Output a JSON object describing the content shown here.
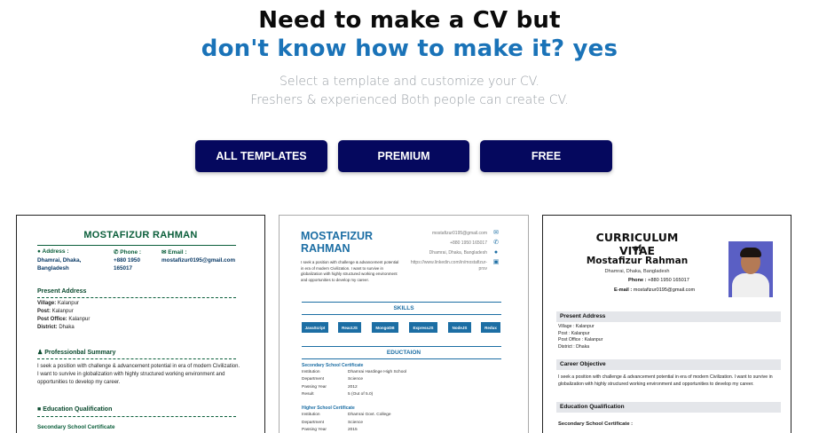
{
  "hero": {
    "line1": "Need to make a CV but",
    "line2": "don't know how to make it? yes",
    "sub1": "Select a template and customize your CV.",
    "sub2": "Freshers & experienced Both people can create CV."
  },
  "filters": {
    "all": "ALL TEMPLATES",
    "premium": "PREMIUM",
    "free": "FREE"
  },
  "colors": {
    "button_bg": "#05085e",
    "accent_blue": "#1a73b8",
    "template1_green": "#0a5e3a"
  },
  "template1": {
    "name": "MOSTAFIZUR RAHMAN",
    "address_label": "Address :",
    "address_value": "Dhamrai, Dhaka, Bangladesh",
    "phone_label": "Phone :",
    "phone_value": "+880 1950 165017",
    "email_label": "Email :",
    "email_value": "mostafizur0195@gmail.com",
    "present_address": "Present Address",
    "village_k": "Village:",
    "village_v": "Kalanpur",
    "post_k": "Post:",
    "post_v": "Kalanpur",
    "postoffice_k": "Post Office:",
    "postoffice_v": "Kalanpur",
    "district_k": "District:",
    "district_v": "Dhaka",
    "summary_title": "Professionbal Summary",
    "summary_text": "I seek a position with challenge & advancement potential in era of modern Civilization. I want to survive in globalization with highly structured working environment and opportunities to develop my career.",
    "education_title": "Education Qualification",
    "ssc": "Secondary School Certificate"
  },
  "template2": {
    "name_line1": "MOSTAFIZUR",
    "name_line2": "RAHMAN",
    "about": "I seek a position with challenge & advancement potential in era of modern Civilization. I want to survive in globalization with highly structured working environment and opportunities to develop my career.",
    "email": "mostafizur0195@gmail.com",
    "phone": "+880 1950 165017",
    "address": "Dhamrai, Dhaka, Bangladesh",
    "linkedin1": "https://www.linkedin.com/in/mostafizur-",
    "linkedin2": "prsv",
    "skills_title": "SKILLS",
    "skills": [
      "JavaScript",
      "ReactJS",
      "MongoDB",
      "ExpressJS",
      "NodeJS",
      "Redux"
    ],
    "education_title": "EDUCTAION",
    "ssc_title": "Secondary School Certificate",
    "ssc_rows": [
      {
        "k": "Institution",
        "v": "Dhamrai Hardinge High School"
      },
      {
        "k": "Department",
        "v": "Science"
      },
      {
        "k": "Passing Year",
        "v": "2012"
      },
      {
        "k": "Result",
        "v": "5 (Out of 5.0)"
      }
    ],
    "hsc_title": "Higher School Certificate",
    "hsc_rows": [
      {
        "k": "Institution",
        "v": "Dhamrai Govt. College"
      },
      {
        "k": "Department",
        "v": "Science"
      },
      {
        "k": "Passing Year",
        "v": "2015"
      }
    ]
  },
  "template3": {
    "title": "CURRICULUM VITAE",
    "of": "of",
    "name": "Mostafizur Rahman",
    "address": "Dhamrai, Dhaka, Bangladesh",
    "phone_label": "Phone :",
    "phone_value": "+880 1950 165017",
    "email_label": "E-mail :",
    "email_value": "mostafizur0195@gmail.com",
    "present_address": "Present Address",
    "village": "Village : Kalanpur",
    "post": "Post : Kalanpur",
    "postoffice": "Post Office : Kalanpur",
    "district": "District : Dhaka",
    "career_title": "Career Objective",
    "career_text": "I seek a position with challenge & advancement potential in era of modern Civilization. I want to survive in globalization with highly structured working environment and opportunities to develop my career.",
    "education_title": "Education Qualification",
    "ssc": "Secondary School Certificate :"
  }
}
